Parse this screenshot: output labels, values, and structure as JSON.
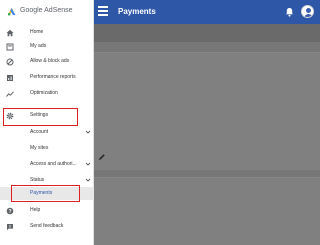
{
  "brand": {
    "name": "Google AdSense",
    "logo_icon": "adsense-logo-icon"
  },
  "header": {
    "title": "Payments",
    "menu_icon": "menu-icon",
    "notifications_icon": "bell-icon",
    "account_icon": "avatar-icon"
  },
  "sidebar": {
    "items": [
      {
        "label": "Home",
        "icon": "home-icon"
      },
      {
        "label": "My ads",
        "icon": "ads-icon"
      },
      {
        "label": "Allow & block ads",
        "icon": "block-icon"
      },
      {
        "label": "Performance reports",
        "icon": "reports-icon"
      },
      {
        "label": "Optimization",
        "icon": "trend-icon"
      },
      {
        "label": "Settings",
        "icon": "gear-icon"
      },
      {
        "label": "Account",
        "icon": "chevron-down-icon"
      },
      {
        "label": "My sites"
      },
      {
        "label": "Access and authori...",
        "icon": "chevron-down-icon"
      },
      {
        "label": "Status",
        "icon": "chevron-down-icon"
      },
      {
        "label": "Payments"
      },
      {
        "label": "Help",
        "icon": "help-icon"
      },
      {
        "label": "Send feedback",
        "icon": "feedback-icon"
      }
    ]
  },
  "colors": {
    "accent": "#2f57a8",
    "highlight": "#e02020",
    "overlay": "#777777"
  }
}
